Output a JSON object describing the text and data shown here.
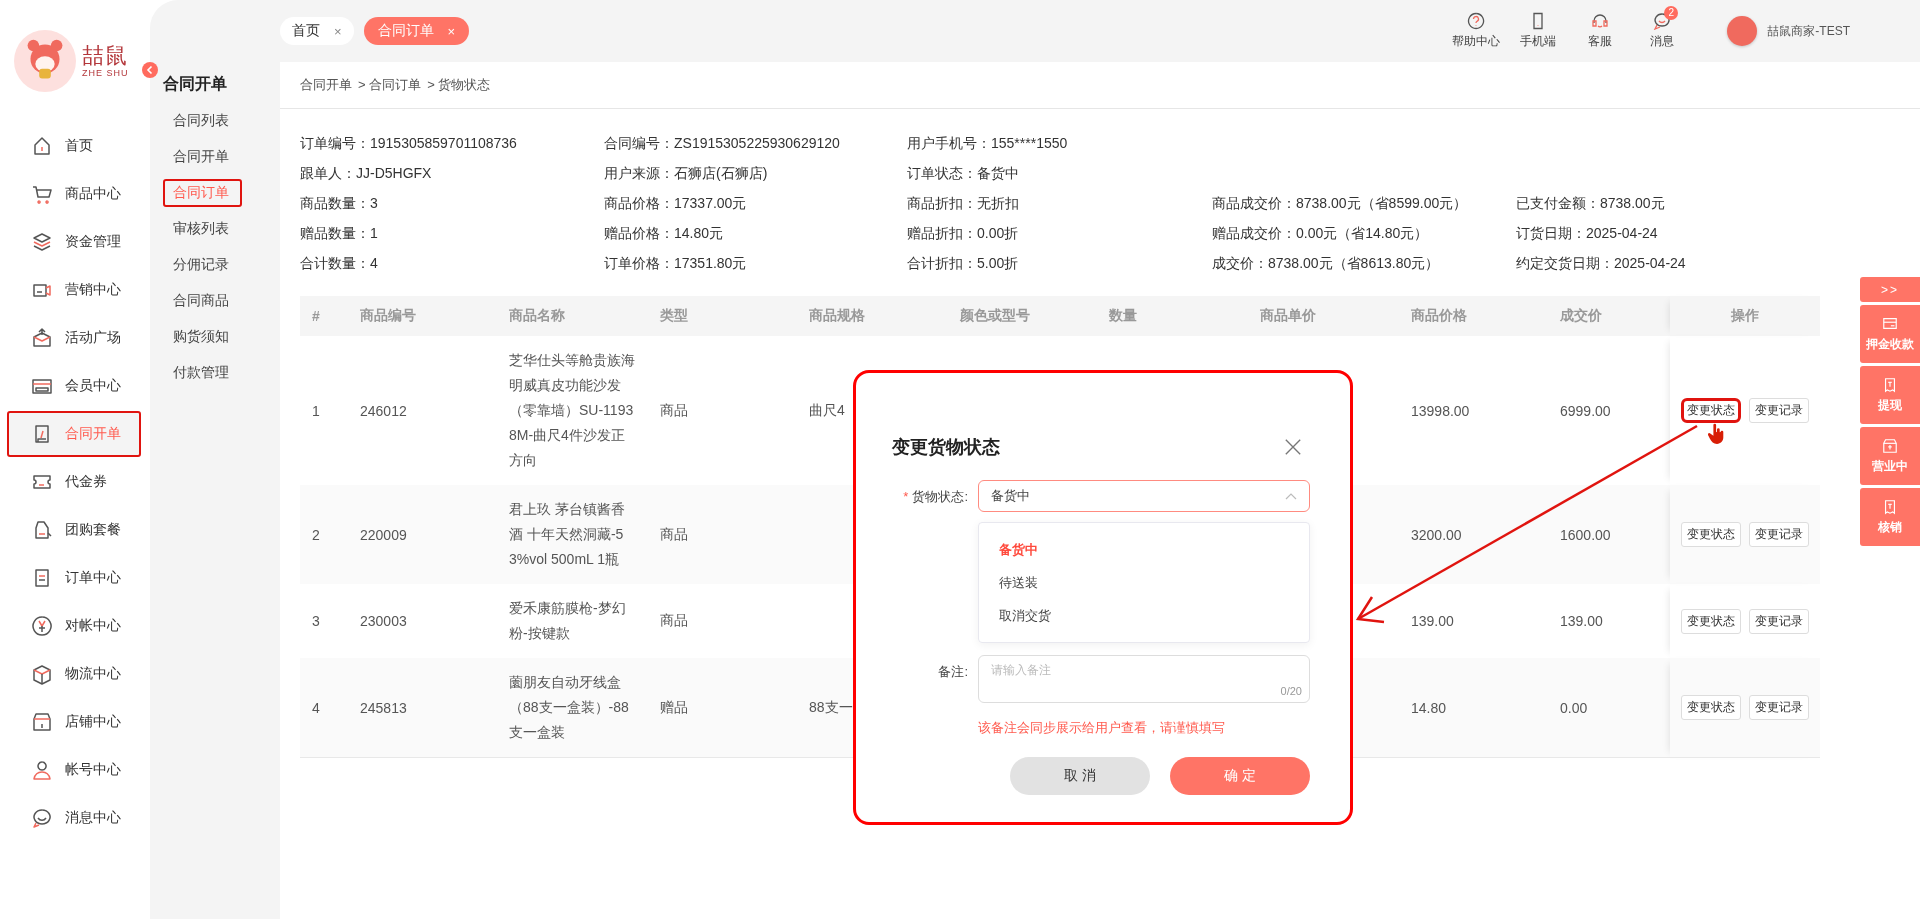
{
  "sidebar": {
    "logo": {
      "title": "喆鼠",
      "subtitle": "ZHE SHU"
    },
    "items": [
      {
        "label": "首页",
        "selected": false,
        "highlighted": false
      },
      {
        "label": "商品中心",
        "selected": false,
        "highlighted": false
      },
      {
        "label": "资金管理",
        "selected": false,
        "highlighted": false
      },
      {
        "label": "营销中心",
        "selected": false,
        "highlighted": false
      },
      {
        "label": "活动广场",
        "selected": false,
        "highlighted": false
      },
      {
        "label": "会员中心",
        "selected": false,
        "highlighted": false
      },
      {
        "label": "合同开单",
        "selected": true,
        "highlighted": true
      },
      {
        "label": "代金券",
        "selected": false,
        "highlighted": false
      },
      {
        "label": "团购套餐",
        "selected": false,
        "highlighted": false
      },
      {
        "label": "订单中心",
        "selected": false,
        "highlighted": false
      },
      {
        "label": "对帐中心",
        "selected": false,
        "highlighted": false
      },
      {
        "label": "物流中心",
        "selected": false,
        "highlighted": false
      },
      {
        "label": "店铺中心",
        "selected": false,
        "highlighted": false
      },
      {
        "label": "帐号中心",
        "selected": false,
        "highlighted": false
      },
      {
        "label": "消息中心",
        "selected": false,
        "highlighted": false
      }
    ]
  },
  "subnav": {
    "title": "合同开单",
    "items": [
      {
        "label": "合同列表",
        "selected": false,
        "highlighted": false
      },
      {
        "label": "合同开单",
        "selected": false,
        "highlighted": false
      },
      {
        "label": "合同订单",
        "selected": true,
        "highlighted": true
      },
      {
        "label": "审核列表",
        "selected": false,
        "highlighted": false
      },
      {
        "label": "分佣记录",
        "selected": false,
        "highlighted": false
      },
      {
        "label": "合同商品",
        "selected": false,
        "highlighted": false
      },
      {
        "label": "购货须知",
        "selected": false,
        "highlighted": false
      },
      {
        "label": "付款管理",
        "selected": false,
        "highlighted": false
      }
    ]
  },
  "tabs": [
    {
      "label": "首页",
      "selected": false,
      "close": "×"
    },
    {
      "label": "合同订单",
      "selected": true,
      "close": "×"
    }
  ],
  "header_actions": [
    {
      "label": "帮助中心",
      "kind": "help"
    },
    {
      "label": "手机端",
      "kind": "phone"
    },
    {
      "label": "客服",
      "kind": "headset"
    },
    {
      "label": "消息",
      "kind": "chat",
      "badge": "2"
    }
  ],
  "user": {
    "name": "喆鼠商家-TEST"
  },
  "breadcrumb": [
    "合同开单",
    "> 合同订单",
    "> 货物状态"
  ],
  "order_info": [
    [
      {
        "label": "订单编号：",
        "value": "1915305859701108736"
      },
      {
        "label": "合同编号：",
        "value": "ZS1915305225930629120"
      },
      {
        "label": "用户手机号：",
        "value": "155****1550"
      }
    ],
    [
      {
        "label": "跟单人：",
        "value": "JJ-D5HGFX"
      },
      {
        "label": "用户来源：",
        "value": "石狮店(石狮店)"
      },
      {
        "label": "订单状态：",
        "value": "备货中"
      }
    ],
    [
      {
        "label": "商品数量：",
        "value": "3"
      },
      {
        "label": "商品价格：",
        "value": "17337.00元"
      },
      {
        "label": "商品折扣：",
        "value": "无折扣"
      },
      {
        "label": "商品成交价：",
        "value": "8738.00元（省8599.00元）"
      },
      {
        "label": "已支付金额：",
        "value": "8738.00元"
      }
    ],
    [
      {
        "label": "赠品数量：",
        "value": "1"
      },
      {
        "label": "赠品价格：",
        "value": "14.80元"
      },
      {
        "label": "赠品折扣：",
        "value": "0.00折"
      },
      {
        "label": "赠品成交价：",
        "value": "0.00元（省14.80元）"
      },
      {
        "label": "订货日期：",
        "value": "2025-04-24"
      }
    ],
    [
      {
        "label": "合计数量：",
        "value": "4"
      },
      {
        "label": "订单价格：",
        "value": "17351.80元"
      },
      {
        "label": "合计折扣：",
        "value": "5.00折"
      },
      {
        "label": "成交价：",
        "value": "8738.00元（省8613.80元）"
      },
      {
        "label": "约定交货日期：",
        "value": "2025-04-24"
      }
    ]
  ],
  "table": {
    "columns": [
      "#",
      "商品编号",
      "商品名称",
      "类型",
      "商品规格",
      "颜色或型号",
      "数量",
      "商品单价",
      "商品价格",
      "成交价",
      "操作"
    ],
    "rows": [
      {
        "no": "1",
        "code": "246012",
        "name": "芝华仕头等舱贵族海明威真皮功能沙发（零靠墙）SU-11938M-曲尺4件沙发正方向",
        "type": "商品",
        "spec": "曲尺4",
        "price": "13998.00",
        "deal": "6999.00",
        "actions": [
          {
            "label": "变更状态",
            "highlighted": true
          },
          {
            "label": "变更记录",
            "highlighted": false
          }
        ]
      },
      {
        "no": "2",
        "code": "220009",
        "name": "君上玖 茅台镇酱香酒 十年天然洞藏-53%vol 500mL 1瓶",
        "type": "商品",
        "price": "3200.00",
        "deal": "1600.00",
        "actions": [
          {
            "label": "变更状态",
            "highlighted": false
          },
          {
            "label": "变更记录",
            "highlighted": false
          }
        ]
      },
      {
        "no": "3",
        "code": "230003",
        "name": "爱禾康筋膜枪-梦幻粉-按键款",
        "type": "商品",
        "price": "139.00",
        "deal": "139.00",
        "actions": [
          {
            "label": "变更状态",
            "highlighted": false
          },
          {
            "label": "变更记录",
            "highlighted": false
          }
        ]
      },
      {
        "no": "4",
        "code": "245813",
        "name": "薗朋友自动牙线盒（88支一盒装）-88支一盒装",
        "type": "赠品",
        "spec": "88支一",
        "price": "14.80",
        "deal": "0.00",
        "actions": [
          {
            "label": "变更状态",
            "highlighted": false
          },
          {
            "label": "变更记录",
            "highlighted": false
          }
        ]
      }
    ]
  },
  "dialog": {
    "title": "变更货物状态",
    "status_label": "货物状态:",
    "required_mark": "*",
    "status_value": "备货中",
    "options": [
      {
        "label": "备货中",
        "selected": true
      },
      {
        "label": "待送装",
        "selected": false
      },
      {
        "label": "取消交货",
        "selected": false
      }
    ],
    "remark_label": "备注:",
    "remark_placeholder": "请输入备注",
    "remark_counter": "0/20",
    "hint": "该备注会同步展示给用户查看，请谨慎填写",
    "buttons": [
      {
        "label": "取 消",
        "kind": "cancel"
      },
      {
        "label": "确 定",
        "kind": "confirm"
      }
    ]
  },
  "side_buttons": [
    {
      "label": ">>",
      "kind": "toggle"
    },
    {
      "label": "押金收款",
      "kind": "card"
    },
    {
      "label": "提现",
      "kind": "receipt"
    },
    {
      "label": "营业中",
      "kind": "store"
    },
    {
      "label": "核销",
      "kind": "receipt"
    }
  ]
}
